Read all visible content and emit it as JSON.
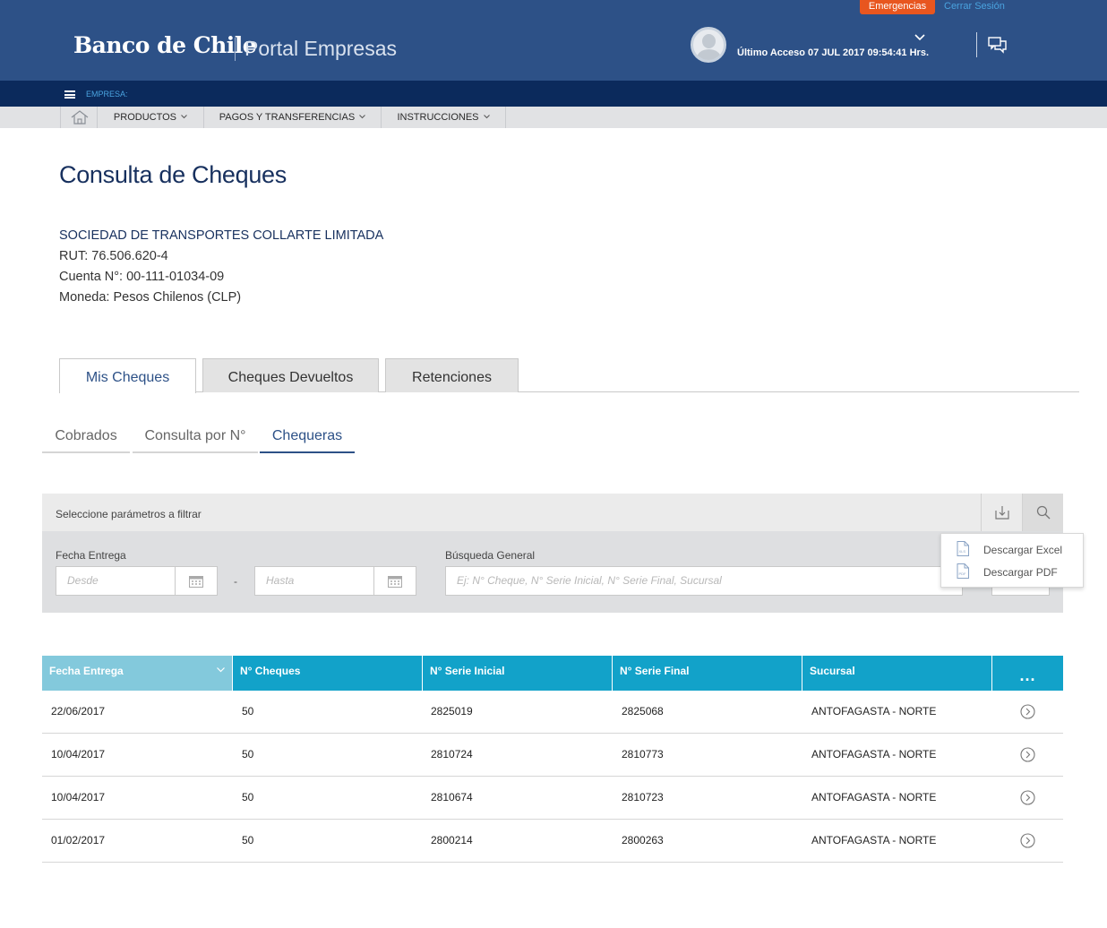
{
  "header": {
    "emergencias_label": "Emergencias",
    "cerrar_sesion_label": "Cerrar Sesión",
    "logo_text": "Banco de Chile",
    "portal_text": "Portal Empresas",
    "ultimo_acceso": "Último Acceso 07 JUL 2017 09:54:41 Hrs."
  },
  "empresa_bar": {
    "label": "EMPRESA:"
  },
  "nav": {
    "items": [
      {
        "label": "PRODUCTOS"
      },
      {
        "label": "PAGOS Y TRANSFERENCIAS"
      },
      {
        "label": "INSTRUCCIONES"
      }
    ]
  },
  "page": {
    "title": "Consulta de Cheques",
    "company": "SOCIEDAD DE TRANSPORTES COLLARTE LIMITADA",
    "rut": "RUT: 76.506.620-4",
    "cuenta": "Cuenta N°: 00-111-01034-09",
    "moneda": "Moneda: Pesos Chilenos (CLP)"
  },
  "tabs": [
    {
      "label": "Mis Cheques",
      "active": true
    },
    {
      "label": "Cheques Devueltos",
      "active": false
    },
    {
      "label": "Retenciones",
      "active": false
    }
  ],
  "subtabs": [
    {
      "label": "Cobrados",
      "active": false
    },
    {
      "label": "Consulta por N°",
      "active": false
    },
    {
      "label": "Chequeras",
      "active": true
    }
  ],
  "filter": {
    "header_label": "Seleccione parámetros a filtrar",
    "fecha_label": "Fecha Entrega",
    "desde_placeholder": "Desde",
    "separator": "-",
    "hasta_placeholder": "Hasta",
    "busqueda_label": "Búsqueda General",
    "busqueda_placeholder": "Ej: N° Cheque, N° Serie Inicial, N° Serie Final, Sucursal",
    "buscar_label": "Buscar"
  },
  "download_menu": {
    "excel_label": "Descargar Excel",
    "pdf_label": "Descargar PDF",
    "excel_icon_text": "XLS",
    "pdf_icon_text": "PDF"
  },
  "table": {
    "columns": [
      "Fecha Entrega",
      "N° Cheques",
      "N° Serie Inicial",
      "N° Serie Final",
      "Sucursal",
      "..."
    ],
    "rows": [
      [
        "22/06/2017",
        "50",
        "2825019",
        "2825068",
        "ANTOFAGASTA - NORTE"
      ],
      [
        "10/04/2017",
        "50",
        "2810724",
        "2810773",
        "ANTOFAGASTA - NORTE"
      ],
      [
        "10/04/2017",
        "50",
        "2810674",
        "2810723",
        "ANTOFAGASTA - NORTE"
      ],
      [
        "01/02/2017",
        "50",
        "2800214",
        "2800263",
        "ANTOFAGASTA - NORTE"
      ]
    ]
  },
  "colors": {
    "header_bg": "#2d5187",
    "empresa_bar_bg": "#0b2a5c",
    "emergencias_bg": "#e8561f",
    "table_header_bg": "#12a2c9",
    "title_color": "#17305e"
  }
}
